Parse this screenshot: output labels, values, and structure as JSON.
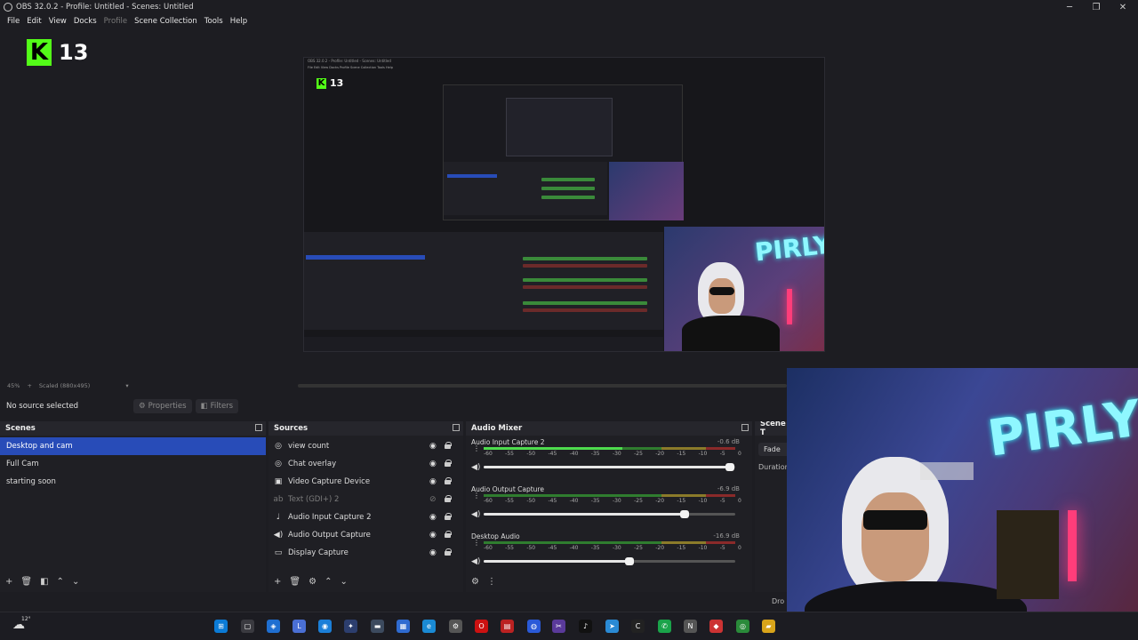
{
  "window": {
    "title": "OBS 32.0.2 - Profile: Untitled - Scenes: Untitled",
    "controls": {
      "minimize": "─",
      "maximize": "❐",
      "close": "✕"
    }
  },
  "menu": [
    "File",
    "Edit",
    "View",
    "Docks",
    "Profile",
    "Scene Collection",
    "Tools",
    "Help"
  ],
  "overlay": {
    "logo_letter": "K",
    "view_count": "13"
  },
  "preview": {
    "inner_title": "OBS 32.0.2 - Profile: Untitled - Scenes: Untitled",
    "inner_menu": "File  Edit  View  Docks  Profile  Scene Collection  Tools  Help",
    "cam_text": "PIRLY"
  },
  "status": {
    "zoom": "45%",
    "scale": "Scaled (880x495)"
  },
  "properties_bar": {
    "no_source": "No source selected",
    "properties_label": "Properties",
    "filters_label": "Filters"
  },
  "scenes": {
    "title": "Scenes",
    "items": [
      "Desktop and cam",
      "Full Cam",
      "starting soon"
    ],
    "selected": 0
  },
  "sources": {
    "title": "Sources",
    "items": [
      {
        "label": "view count",
        "icon": "globe-icon",
        "dim": false
      },
      {
        "label": "Chat overlay",
        "icon": "globe-icon",
        "dim": false
      },
      {
        "label": "Video Capture Device",
        "icon": "camera-icon",
        "dim": false
      },
      {
        "label": "Text (GDI+) 2",
        "icon": "text-icon",
        "dim": true
      },
      {
        "label": "Audio Input Capture 2",
        "icon": "mic-icon",
        "dim": false
      },
      {
        "label": "Audio Output Capture",
        "icon": "speaker-icon",
        "dim": false
      },
      {
        "label": "Display Capture",
        "icon": "monitor-icon",
        "dim": false
      }
    ]
  },
  "mixer": {
    "title": "Audio Mixer",
    "scale": [
      "-60",
      "-55",
      "-50",
      "-45",
      "-40",
      "-35",
      "-30",
      "-25",
      "-20",
      "-15",
      "-10",
      "-5",
      "0"
    ],
    "channels": [
      {
        "name": "Audio Input Capture 2",
        "db": "-0.6 dB",
        "level": 0.55,
        "volume": 0.98
      },
      {
        "name": "Audio Output Capture",
        "db": "-6.9 dB",
        "level": 0.0,
        "volume": 0.8
      },
      {
        "name": "Desktop Audio",
        "db": "-16.9 dB",
        "level": 0.0,
        "volume": 0.58
      }
    ]
  },
  "transitions": {
    "title": "Scene T",
    "fade": "Fade",
    "duration": "Duration"
  },
  "bottom_status": {
    "right_text": "Dro"
  },
  "taskbar": {
    "temp": "12°"
  },
  "colors": {
    "accent": "#284cb8",
    "kick_green": "#53fc18",
    "neon": "#8ff7ff"
  }
}
